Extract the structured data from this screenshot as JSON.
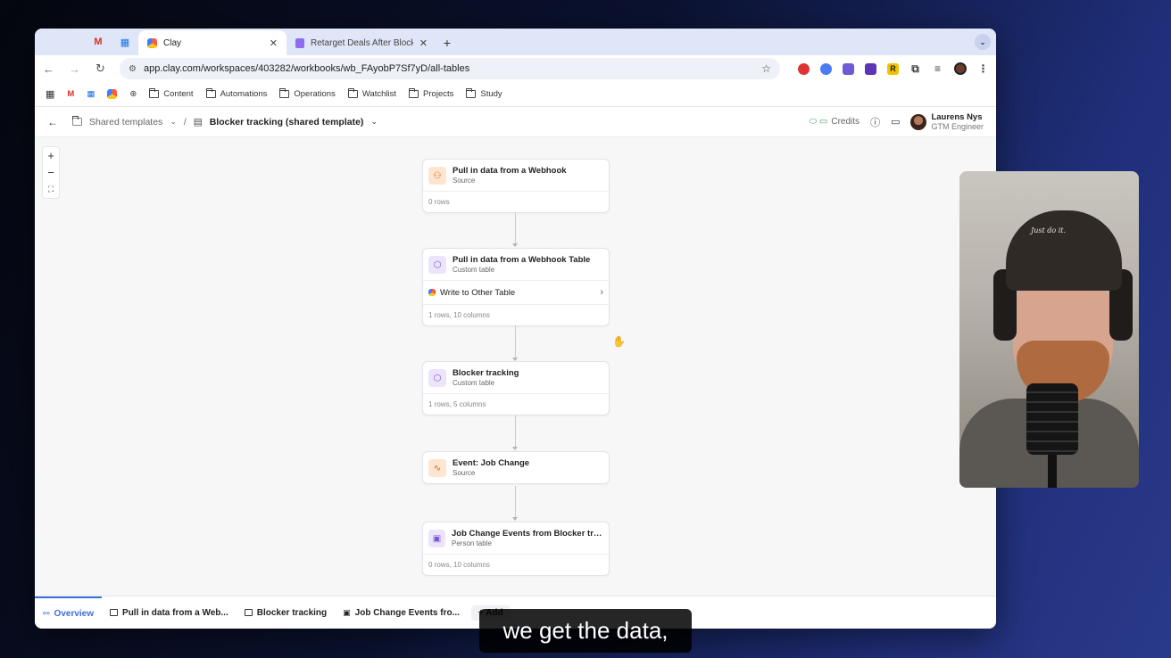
{
  "browser": {
    "tabs": [
      {
        "label": "Clay",
        "active": true
      },
      {
        "label": "Retarget Deals After Blocker",
        "active": false
      }
    ],
    "url": "app.clay.com/workspaces/403282/workbooks/wb_FAyobP7Sf7yD/all-tables",
    "bookmarks": [
      "Content",
      "Automations",
      "Operations",
      "Watchlist",
      "Projects",
      "Study"
    ]
  },
  "header": {
    "breadcrumb_parent": "Shared templates",
    "breadcrumb_separator": "/",
    "current": "Blocker tracking (shared template)",
    "credits_label": "Credits",
    "user_name": "Laurens Nys",
    "user_role": "GTM Engineer"
  },
  "zoom": {
    "in": "+",
    "out": "−",
    "fit": "⛶"
  },
  "nodes": [
    {
      "title": "Pull in data from a Webhook",
      "subtitle": "Source",
      "footer": "0 rows"
    },
    {
      "title": "Pull in data from a Webhook Table",
      "subtitle": "Custom table",
      "action": "Write to Other Table",
      "footer": "1 rows, 10 columns"
    },
    {
      "title": "Blocker tracking",
      "subtitle": "Custom table",
      "footer": "1 rows, 5 columns"
    },
    {
      "title": "Event: Job Change",
      "subtitle": "Source"
    },
    {
      "title": "Job Change Events from Blocker tra...",
      "subtitle": "Person table",
      "footer": "0 rows, 10 columns"
    }
  ],
  "bottom_tabs": [
    {
      "label": "Overview",
      "active": true
    },
    {
      "label": "Pull in data from a Web..."
    },
    {
      "label": "Blocker tracking"
    },
    {
      "label": "Job Change Events fro..."
    }
  ],
  "bottom_add": "+ Add",
  "webcam": {
    "cap_text": "Just do it."
  },
  "caption": "we get the data,",
  "colors": {
    "accent": "#3b6fd9",
    "credits": "#4b9a62"
  }
}
